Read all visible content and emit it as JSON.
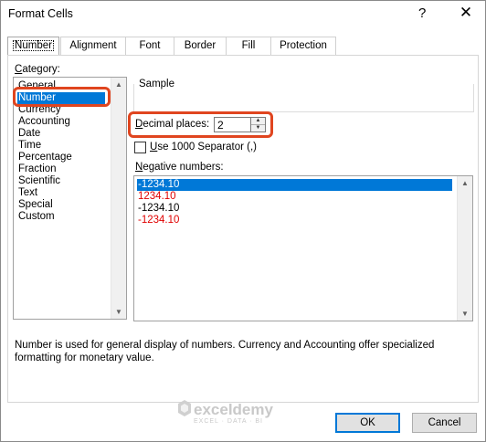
{
  "window": {
    "title": "Format Cells",
    "help_glyph": "?",
    "close_glyph": "✕"
  },
  "tabs": [
    {
      "label": "Number",
      "active": true
    },
    {
      "label": "Alignment"
    },
    {
      "label": "Font"
    },
    {
      "label": "Border"
    },
    {
      "label": "Fill"
    },
    {
      "label": "Protection"
    }
  ],
  "category": {
    "label": "Category:",
    "items": [
      "General",
      "Number",
      "Currency",
      "Accounting",
      "Date",
      "Time",
      "Percentage",
      "Fraction",
      "Scientific",
      "Text",
      "Special",
      "Custom"
    ],
    "selected": "Number"
  },
  "sample": {
    "legend": "Sample"
  },
  "decimal_places": {
    "label": "Decimal places:",
    "value": "2"
  },
  "separator": {
    "label": "Use 1000 Separator (,)",
    "checked": false
  },
  "negative_numbers": {
    "label": "Negative numbers:",
    "items": [
      {
        "text": "-1234.10",
        "color": "#000000",
        "selected": true
      },
      {
        "text": "1234.10",
        "color": "#e00000"
      },
      {
        "text": "-1234.10",
        "color": "#000000"
      },
      {
        "text": "-1234.10",
        "color": "#e00000"
      }
    ]
  },
  "description": "Number is used for general display of numbers.  Currency and Accounting offer specialized formatting for monetary value.",
  "buttons": {
    "ok": "OK",
    "cancel": "Cancel"
  },
  "watermark": {
    "name": "exceldemy",
    "tagline": "EXCEL · DATA · BI"
  },
  "colors": {
    "accent": "#0078d7",
    "highlight": "#e0451f",
    "negative_red": "#e00000"
  }
}
